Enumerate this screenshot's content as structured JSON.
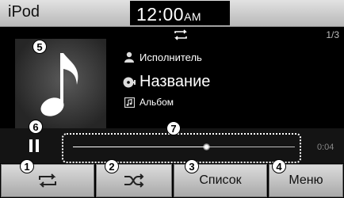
{
  "header": {
    "source_title": "iPod",
    "clock_time": "12:00",
    "clock_ampm": "AM"
  },
  "track": {
    "counter": "1/3",
    "artist": "Исполнитель",
    "title": "Название",
    "album": "Альбом",
    "elapsed": "0:04",
    "progress": 0.6,
    "repeat_icon": "repeat-indicator-icon"
  },
  "buttons": {
    "repeat_icon": "repeat-icon",
    "shuffle_icon": "shuffle-icon",
    "list_label": "Список",
    "menu_label": "Меню"
  },
  "callouts": [
    "1",
    "2",
    "3",
    "4",
    "5",
    "6",
    "7"
  ],
  "colors": {
    "background": "#000000",
    "button_face": "#c8c8c8",
    "status_bar": "#d0d0d0",
    "text": "#ffffff"
  }
}
